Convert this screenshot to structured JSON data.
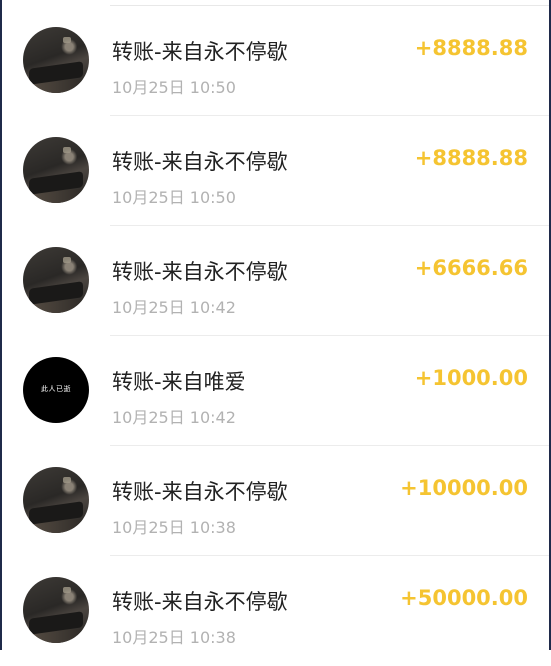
{
  "transactions": [
    {
      "title": "转账-来自永不停歇",
      "time": "10月25日 10:50",
      "amount": "+8888.88",
      "avatar": "room-photo"
    },
    {
      "title": "转账-来自永不停歇",
      "time": "10月25日 10:50",
      "amount": "+8888.88",
      "avatar": "room-photo"
    },
    {
      "title": "转账-来自永不停歇",
      "time": "10月25日 10:42",
      "amount": "+6666.66",
      "avatar": "room-photo"
    },
    {
      "title": "转账-来自唯爱",
      "time": "10月25日 10:42",
      "amount": "+1000.00",
      "avatar": "black-text",
      "avatar_text": "此人已逝"
    },
    {
      "title": "转账-来自永不停歇",
      "time": "10月25日 10:38",
      "amount": "+10000.00",
      "avatar": "room-photo"
    },
    {
      "title": "转账-来自永不停歇",
      "time": "10月25日 10:38",
      "amount": "+50000.00",
      "avatar": "room-photo"
    }
  ],
  "colors": {
    "amount": "#f5c431",
    "title": "#222222",
    "time": "#b2b2b2",
    "divider": "#ececec"
  }
}
